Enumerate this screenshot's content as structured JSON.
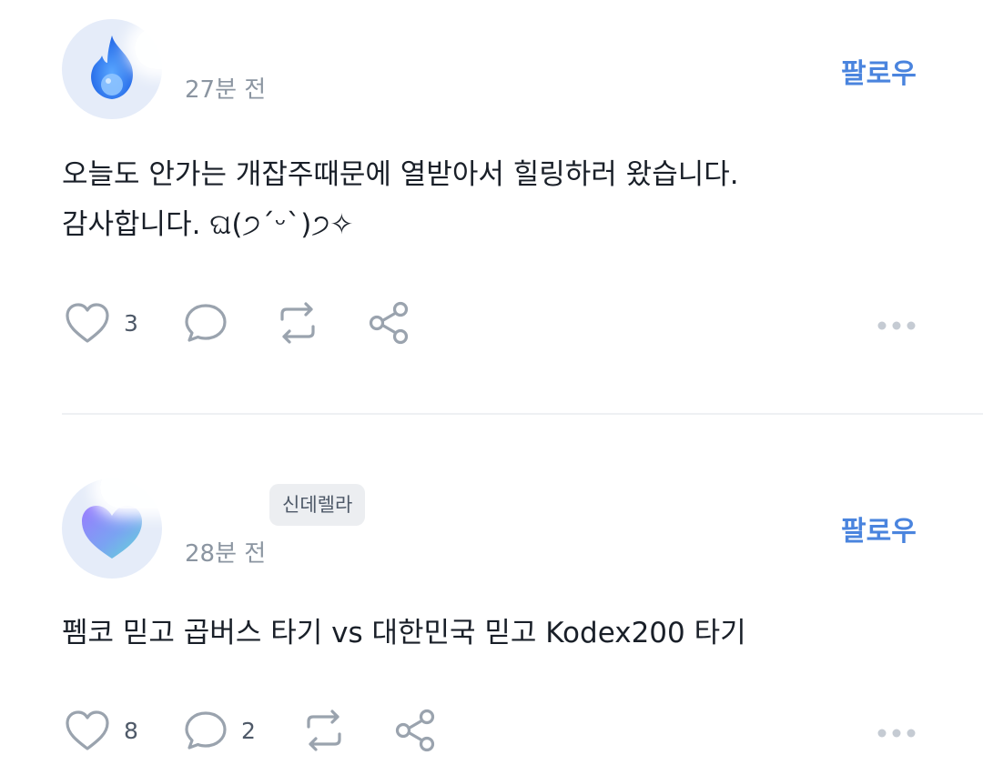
{
  "colors": {
    "accent": "#4a84de",
    "text": "#191f28",
    "muted": "#8b95a1",
    "icon": "#9aa3ae"
  },
  "posts": [
    {
      "avatar_icon": "blue-flame-icon",
      "time": "27분 전",
      "follow_label": "팔로우",
      "body_lines": [
        "오늘도 안가는 개잡주때문에 열받아서 힐링하러 왔습니다.",
        "감사합니다. ଘ(੭ˊᵕˋ)੭✧"
      ],
      "likes": "3",
      "comments": "",
      "icons": [
        "heart-icon",
        "comment-icon",
        "repost-icon",
        "share-icon",
        "more-icon"
      ]
    },
    {
      "avatar_icon": "purple-heart-icon",
      "badge": "신데렐라",
      "time": "28분 전",
      "follow_label": "팔로우",
      "body_lines": [
        "펨코 믿고 곱버스 타기 vs 대한민국 믿고 Kodex200 타기"
      ],
      "likes": "8",
      "comments": "2",
      "icons": [
        "heart-icon",
        "comment-icon",
        "repost-icon",
        "share-icon",
        "more-icon"
      ]
    }
  ]
}
